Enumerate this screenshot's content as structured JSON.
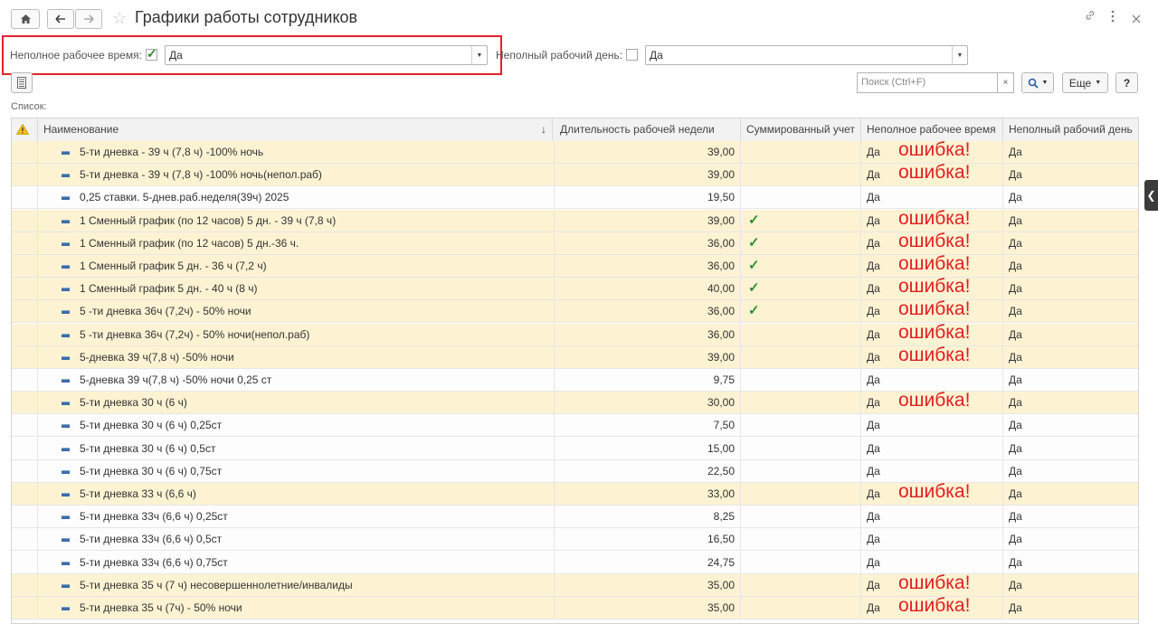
{
  "window": {
    "title": "Графики работы сотрудников",
    "home_icon": "home-icon",
    "back_icon": "arrow-left-icon",
    "forward_icon": "arrow-right-icon",
    "star_icon": "star-icon",
    "link_icon": "link-icon",
    "more_icon": "more-vertical-icon",
    "close_icon": "close-icon"
  },
  "filters": {
    "part_time": {
      "label": "Неполное рабочее время:",
      "checked": true,
      "value": "Да"
    },
    "part_day": {
      "label": "Неполный рабочий день:",
      "checked": false,
      "value": "Да"
    }
  },
  "toolbar": {
    "search_placeholder": "Поиск (Ctrl+F)",
    "search_clear": "×",
    "search_icon": "search-icon",
    "more_label": "Еще",
    "help_label": "?"
  },
  "list_label": "Список:",
  "columns": {
    "warning_icon": "warning-icon",
    "name": "Наименование",
    "sort_arrow": "↓",
    "duration": "Длительность рабочей недели",
    "summed": "Суммированный учет",
    "part_time": "Неполное рабочее время",
    "part_day": "Неполный рабочий день"
  },
  "error_label": "ошибка!",
  "check_symbol": "✓",
  "rows": [
    {
      "name": " 5-ти дневка - 39 ч (7,8 ч) -100% ночь",
      "hours": "39,00",
      "summed": false,
      "part_time": "Да",
      "part_day": "Да",
      "error": true
    },
    {
      "name": " 5-ти дневка - 39 ч (7,8 ч) -100% ночь(непол.раб)",
      "hours": "39,00",
      "summed": false,
      "part_time": "Да",
      "part_day": "Да",
      "error": true
    },
    {
      "name": "0,25 ставки. 5-днев.раб.неделя(39ч) 2025",
      "hours": "19,50",
      "summed": false,
      "part_time": "Да",
      "part_day": "Да",
      "error": false
    },
    {
      "name": "1 Сменный график (по 12 часов) 5 дн. - 39 ч (7,8 ч)",
      "hours": "39,00",
      "summed": true,
      "part_time": "Да",
      "part_day": "Да",
      "error": true
    },
    {
      "name": "1 Сменный график (по 12 часов) 5 дн.-36 ч.",
      "hours": "36,00",
      "summed": true,
      "part_time": "Да",
      "part_day": "Да",
      "error": true
    },
    {
      "name": "1 Сменный график 5 дн. - 36 ч (7,2 ч)",
      "hours": "36,00",
      "summed": true,
      "part_time": "Да",
      "part_day": "Да",
      "error": true
    },
    {
      "name": "1 Сменный график 5 дн. - 40 ч (8 ч)",
      "hours": "40,00",
      "summed": true,
      "part_time": "Да",
      "part_day": "Да",
      "error": true
    },
    {
      "name": "5 -ти дневка 36ч (7,2ч) - 50% ночи",
      "hours": "36,00",
      "summed": true,
      "part_time": "Да",
      "part_day": "Да",
      "error": true
    },
    {
      "name": "5 -ти дневка 36ч (7,2ч) - 50% ночи(непол.раб)",
      "hours": "36,00",
      "summed": false,
      "part_time": "Да",
      "part_day": "Да",
      "error": true
    },
    {
      "name": "5-дневка 39 ч(7,8 ч) -50% ночи",
      "hours": "39,00",
      "summed": false,
      "part_time": "Да",
      "part_day": "Да",
      "error": true
    },
    {
      "name": "5-дневка 39 ч(7,8 ч) -50% ночи 0,25 ст",
      "hours": "9,75",
      "summed": false,
      "part_time": "Да",
      "part_day": "Да",
      "error": false
    },
    {
      "name": "5-ти дневка 30 ч (6 ч)",
      "hours": "30,00",
      "summed": false,
      "part_time": "Да",
      "part_day": "Да",
      "error": true
    },
    {
      "name": "5-ти дневка 30 ч (6 ч) 0,25ст",
      "hours": "7,50",
      "summed": false,
      "part_time": "Да",
      "part_day": "Да",
      "error": false
    },
    {
      "name": "5-ти дневка 30 ч (6 ч) 0,5ст",
      "hours": "15,00",
      "summed": false,
      "part_time": "Да",
      "part_day": "Да",
      "error": false
    },
    {
      "name": "5-ти дневка 30 ч (6 ч) 0,75ст",
      "hours": "22,50",
      "summed": false,
      "part_time": "Да",
      "part_day": "Да",
      "error": false
    },
    {
      "name": "5-ти дневка 33 ч (6,6 ч)",
      "hours": "33,00",
      "summed": false,
      "part_time": "Да",
      "part_day": "Да",
      "error": true
    },
    {
      "name": "5-ти дневка 33ч (6,6 ч) 0,25ст",
      "hours": "8,25",
      "summed": false,
      "part_time": "Да",
      "part_day": "Да",
      "error": false
    },
    {
      "name": "5-ти дневка 33ч (6,6 ч) 0,5ст",
      "hours": "16,50",
      "summed": false,
      "part_time": "Да",
      "part_day": "Да",
      "error": false
    },
    {
      "name": "5-ти дневка 33ч (6,6 ч) 0,75ст",
      "hours": "24,75",
      "summed": false,
      "part_time": "Да",
      "part_day": "Да",
      "error": false
    },
    {
      "name": "5-ти дневка 35 ч (7 ч) несовершеннолетние/инвалиды",
      "hours": "35,00",
      "summed": false,
      "part_time": "Да",
      "part_day": "Да",
      "error": true
    },
    {
      "name": "5-ти дневка 35 ч (7ч) - 50% ночи",
      "hours": "35,00",
      "summed": false,
      "part_time": "Да",
      "part_day": "Да",
      "error": true
    }
  ],
  "side_tab_icon": "chevron-left-icon",
  "colors": {
    "highlight_row": "#fdf3d3",
    "error_text": "#e02020",
    "red_frame": "#e0232d",
    "check_green": "#2d8f2d"
  }
}
